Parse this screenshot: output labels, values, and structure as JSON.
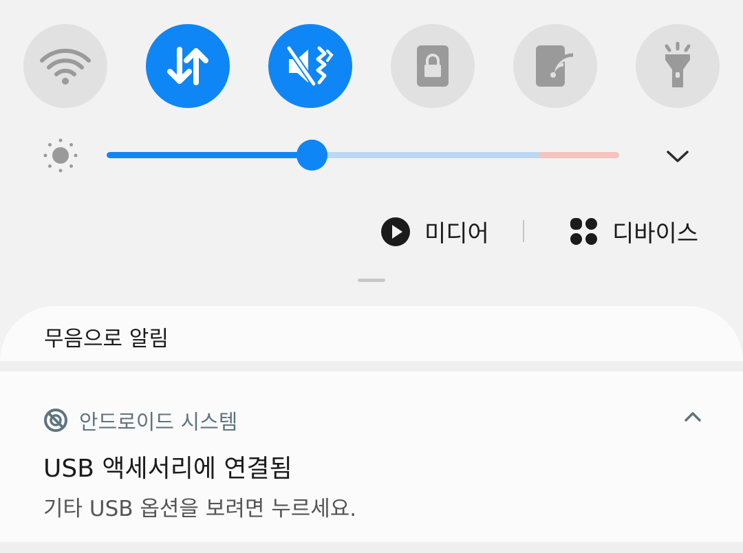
{
  "quick_settings": {
    "tiles": [
      {
        "icon": "wifi-icon",
        "active": false
      },
      {
        "icon": "mobile-data-icon",
        "active": true
      },
      {
        "icon": "vibrate-mute-icon",
        "active": true
      },
      {
        "icon": "screen-lock-icon",
        "active": false
      },
      {
        "icon": "nfc-payment-icon",
        "active": false
      },
      {
        "icon": "flashlight-icon",
        "active": false
      }
    ],
    "accent_color": "#0f86f6",
    "inactive_color": "#e1e1e1"
  },
  "brightness": {
    "level": 0.4,
    "icon": "brightness-sun-icon"
  },
  "media_row": {
    "media_label": "미디어",
    "devices_label": "디바이스"
  },
  "silent_section": {
    "label": "무음으로 알림"
  },
  "notification": {
    "app_name": "안드로이드 시스템",
    "title": "USB 액세서리에 연결됨",
    "body": "기타 USB 옵션을 보려면 누르세요."
  }
}
